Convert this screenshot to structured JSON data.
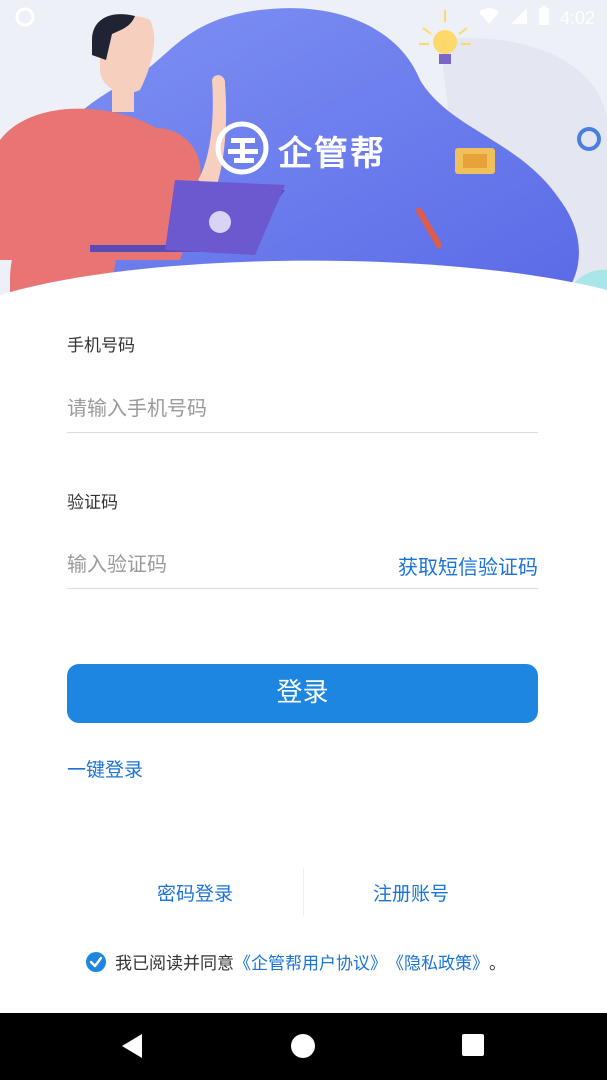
{
  "status_bar": {
    "time": "4:02"
  },
  "app": {
    "name": "企管帮"
  },
  "form": {
    "phone_label": "手机号码",
    "phone_placeholder": "请输入手机号码",
    "code_label": "验证码",
    "code_placeholder": "输入验证码",
    "get_code_label": "获取短信验证码",
    "login_label": "登录",
    "one_key_login_label": "一键登录"
  },
  "footer": {
    "password_login_label": "密码登录",
    "register_label": "注册账号",
    "agreement": {
      "checked": true,
      "prefix": "我已阅读并同意",
      "user_agreement": "《企管帮用户协议》",
      "privacy_policy": "《隐私政策》",
      "suffix": "。"
    }
  },
  "nav_bar": {
    "icons": [
      "back-icon",
      "home-icon",
      "recents-icon"
    ]
  },
  "colors": {
    "accent": "#1d86e0",
    "link": "#1a73d9",
    "hero_blue": "#6a7ff2"
  }
}
